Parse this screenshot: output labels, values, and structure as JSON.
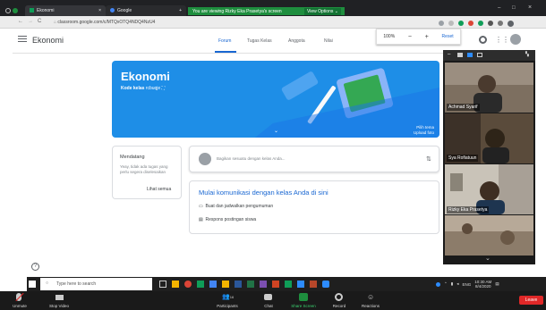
{
  "browser": {
    "tab1_title": "Ekonomi",
    "tab2_title": "Google",
    "url": "classroom.google.com/c/MTQxOTQ4NDQ4NzU4",
    "share_banner_text": "You are viewing Rizky Eka Prasetya's screen",
    "view_options": "View Options ⌄"
  },
  "zoom_bar": {
    "percent": "100%",
    "minus": "−",
    "plus": "+",
    "reset": "Reset"
  },
  "classroom": {
    "class_name": "Ekonomi",
    "tabs": [
      "Forum",
      "Tugas Kelas",
      "Anggota",
      "Nilai"
    ],
    "banner_title": "Ekonomi",
    "class_code_label": "Kode kelas",
    "class_code": "rcbuqje",
    "banner_info_1": "Pilih tema",
    "banner_info_2": "Upload foto",
    "upcoming_title": "Mendatang",
    "upcoming_text": "Yeay, tidak ada tugas yang perlu segera diselesaikan",
    "view_all": "Lihat semua",
    "announce_placeholder": "Bagikan sesuatu dengan kelas Anda...",
    "comm_title": "Mulai komunikasi dengan kelas Anda di sini",
    "comm_item1": "Buat dan jadwalkan pengumuman",
    "comm_item2": "Respons postingan siswa",
    "help": "?"
  },
  "participants": [
    {
      "name": "Achmad Syarif",
      "bg": "#7a6a5a"
    },
    {
      "name": "Sya Rofiatuun",
      "bg": "#5a4a3a"
    },
    {
      "name": "Rizky Eka Prasetya",
      "bg": "#8a7a6a"
    }
  ],
  "taskbar": {
    "search_placeholder": "Type here to search",
    "time": "10:30 AM",
    "date": "8/4/2020",
    "lang": "ENG"
  },
  "zoom_controls": {
    "unmute": "Unmute",
    "stop_video": "Stop Video",
    "participants": "Participants",
    "participant_count": "16",
    "chat": "Chat",
    "share_screen": "Share Screen",
    "record": "Record",
    "reactions": "Reactions",
    "leave": "Leave"
  },
  "colors": {
    "accent": "#1967d2",
    "banner": "#1e8ee7",
    "share_green": "#1e8e3e",
    "leave_red": "#e02828"
  }
}
